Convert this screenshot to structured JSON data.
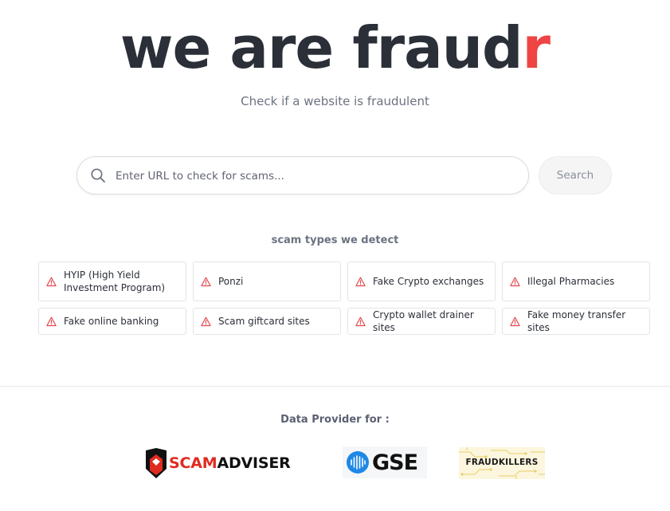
{
  "hero": {
    "title_main": "we are fraud",
    "title_accent": "r",
    "subtitle": "Check if a website is fraudulent"
  },
  "search": {
    "placeholder": "Enter URL to check for scams...",
    "value": "",
    "button_label": "Search",
    "icon": "search-icon"
  },
  "scam_types": {
    "heading": "scam types we detect",
    "icon": "warning-triangle-icon",
    "items": [
      {
        "label": "HYIP (High Yield Investment Program)"
      },
      {
        "label": "Ponzi"
      },
      {
        "label": "Fake Crypto exchanges"
      },
      {
        "label": "Illegal Pharmacies"
      },
      {
        "label": "Fake online banking"
      },
      {
        "label": "Scam giftcard sites"
      },
      {
        "label": "Crypto wallet drainer sites"
      },
      {
        "label": "Fake money transfer sites"
      }
    ]
  },
  "providers": {
    "heading": "Data Provider for :",
    "logos": [
      {
        "name": "ScamAdviser",
        "wordmark_red": "SCAM",
        "wordmark_black": "ADVISER"
      },
      {
        "name": "GSE",
        "wordmark": "GSE"
      },
      {
        "name": "FraudKillers",
        "wordmark": "FRAUDKILLERS"
      }
    ]
  },
  "colors": {
    "accent": "#ef4444",
    "text": "#2b2f38",
    "muted": "#6b7280",
    "warning_icon": "#e5484d",
    "scamadviser_red": "#e02b20",
    "gse_blue": "#1e88e5",
    "fraudkillers_gold": "#e8cf6a"
  }
}
